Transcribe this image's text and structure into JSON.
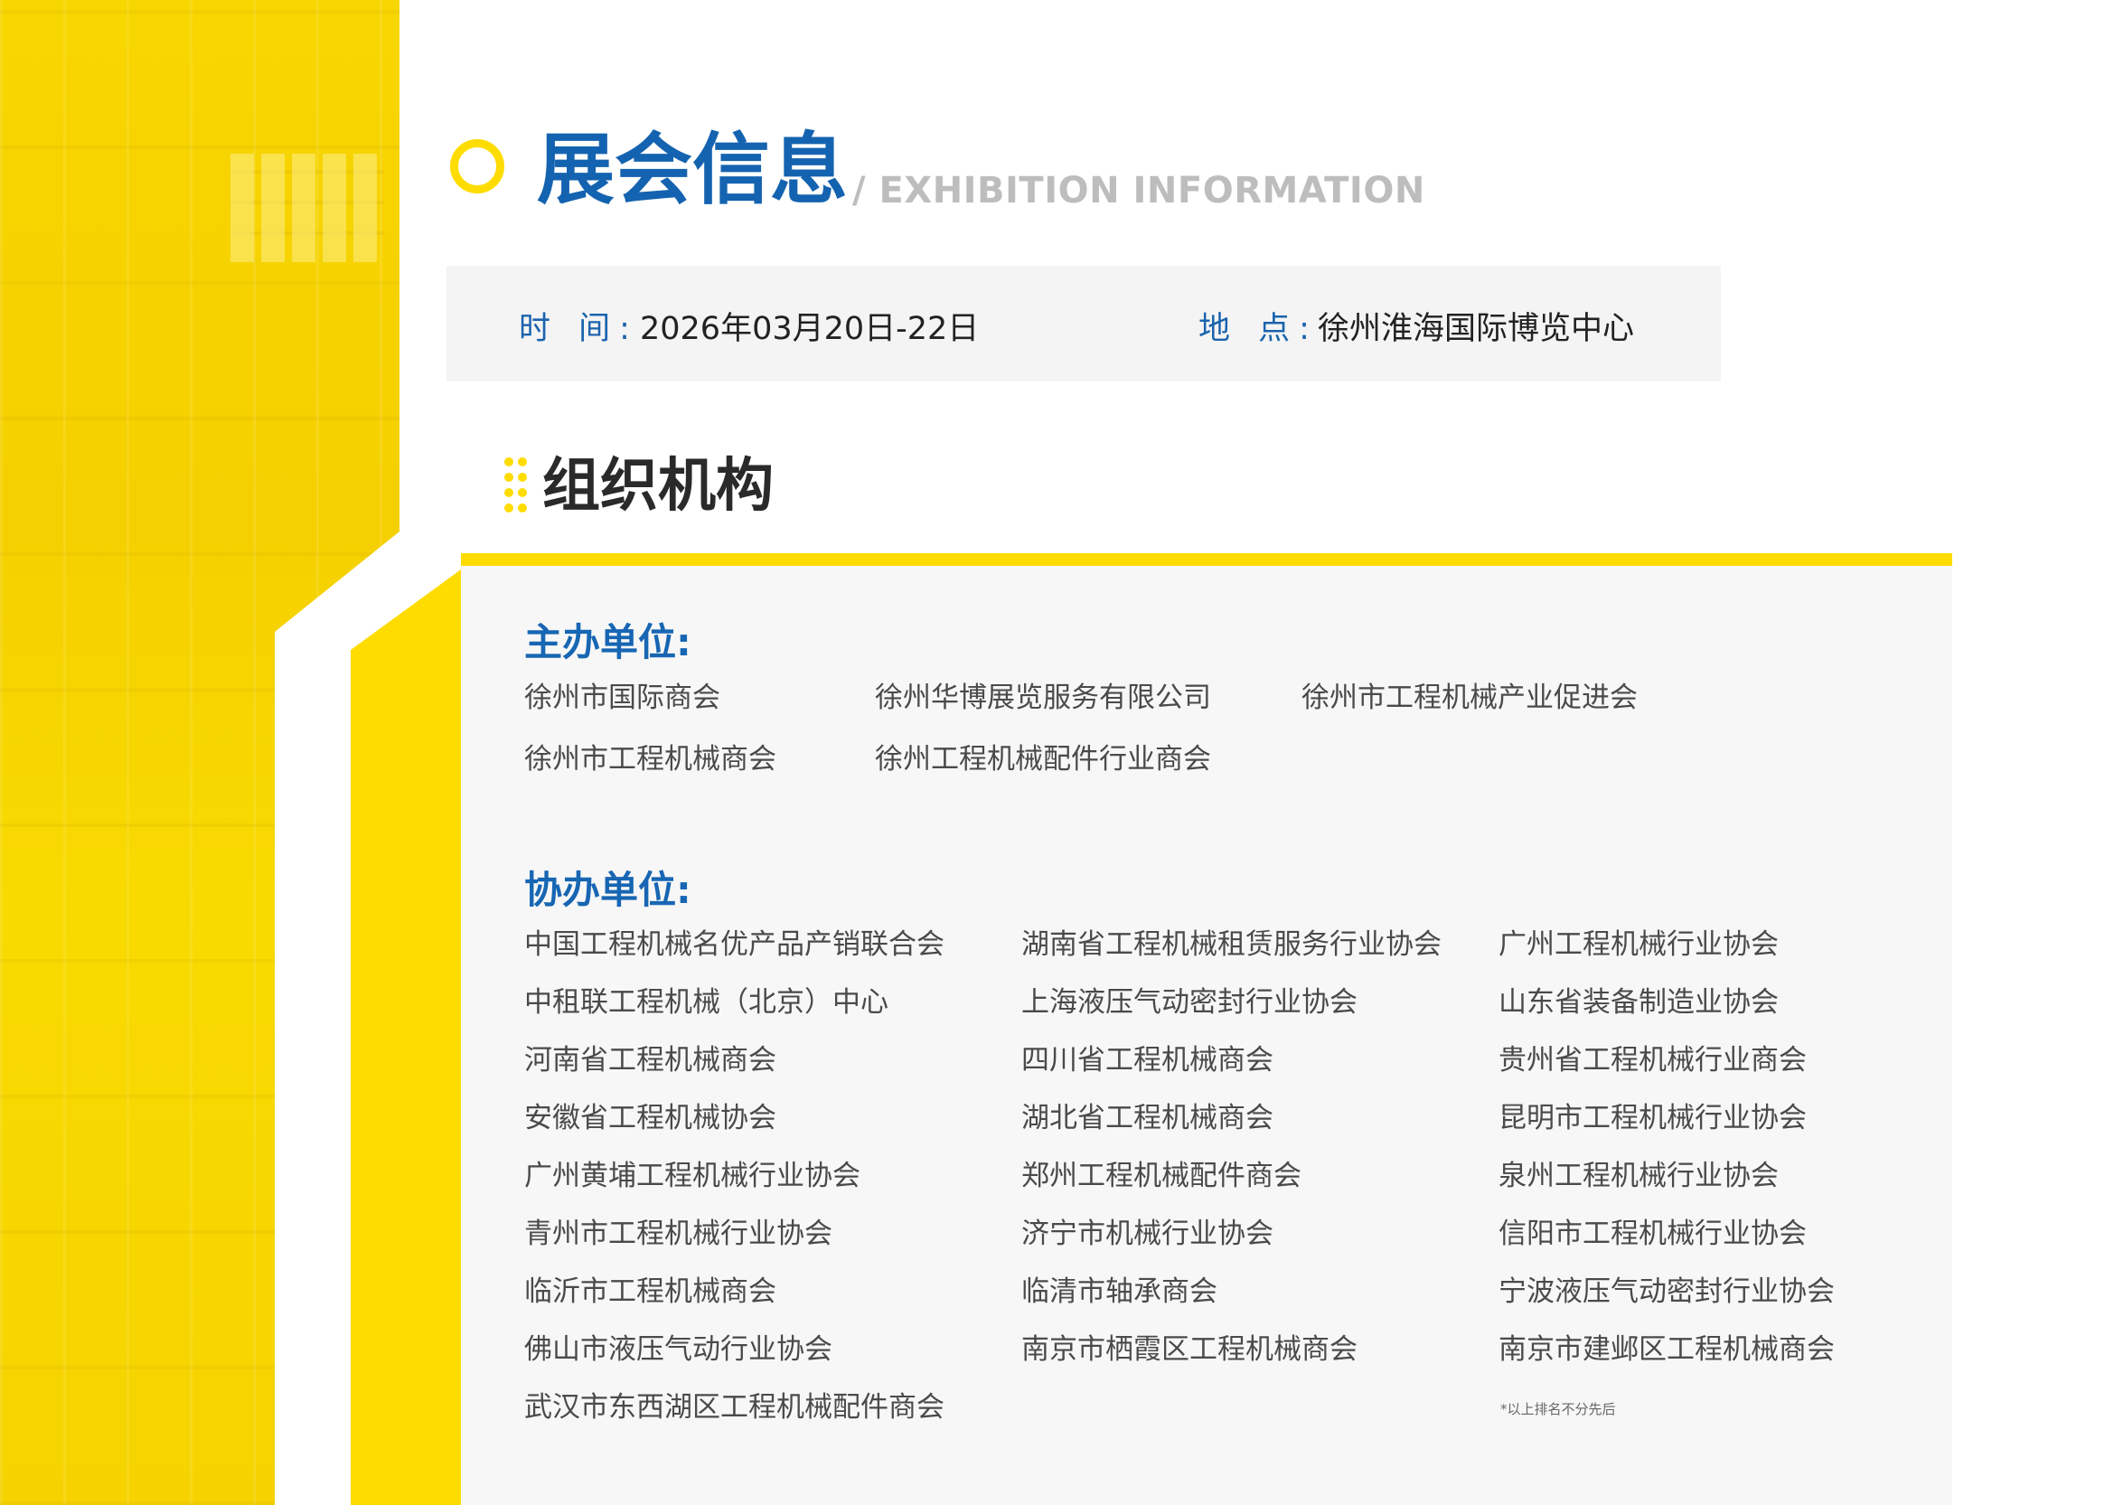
{
  "header": {
    "title": "展会信息",
    "subtitle": "/ EXHIBITION INFORMATION"
  },
  "info": {
    "time_label": "时 间:",
    "time_value": "2026年03月20日-22日",
    "place_label": "地 点:",
    "place_value": "徐州淮海国际博览中心"
  },
  "organization": {
    "title": "组织机构",
    "hosts_heading": "主办单位:",
    "hosts": [
      "徐州市国际商会",
      "徐州华博展览服务有限公司",
      "徐州市工程机械产业促进会",
      "徐州市工程机械商会",
      "徐州工程机械配件行业商会"
    ],
    "co_heading": "协办单位:",
    "co_columns": [
      [
        "中国工程机械名优产品产销联合会",
        "中租联工程机械（北京）中心",
        "河南省工程机械商会",
        "安徽省工程机械协会",
        "广州黄埔工程机械行业协会",
        "青州市工程机械行业协会",
        "临沂市工程机械商会",
        "佛山市液压气动行业协会",
        "武汉市东西湖区工程机械配件商会"
      ],
      [
        "湖南省工程机械租赁服务行业协会",
        "上海液压气动密封行业协会",
        "四川省工程机械商会",
        "湖北省工程机械商会",
        "郑州工程机械配件商会",
        "济宁市机械行业协会",
        "临清市轴承商会",
        "南京市栖霞区工程机械商会"
      ],
      [
        "广州工程机械行业协会",
        "山东省装备制造业协会",
        "贵州省工程机械行业商会",
        "昆明市工程机械行业协会",
        "泉州工程机械行业协会",
        "信阳市工程机械行业协会",
        "宁波液压气动密封行业协会",
        "南京市建邺区工程机械商会"
      ]
    ],
    "note": "*以上排名不分先后"
  },
  "colors": {
    "accent_yellow": "#ffdc00",
    "title_blue": "#1463b0",
    "panel_gray": "#f7f7f7"
  }
}
